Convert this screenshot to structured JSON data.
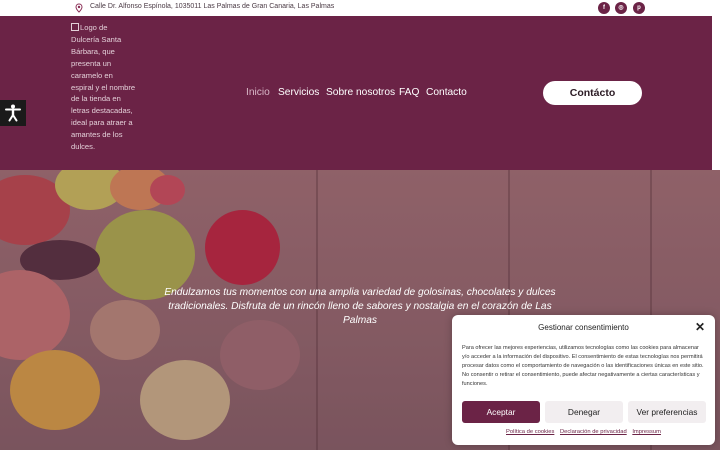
{
  "topbar": {
    "address_icon": "map-pin-icon",
    "address": "Calle Dr. Alfonso Espínola, 1035011 Las Palmas de Gran Canaria, Las Palmas",
    "social": [
      {
        "icon": "facebook-icon",
        "glyph": "f"
      },
      {
        "icon": "instagram-icon",
        "glyph": "◎"
      },
      {
        "icon": "pinterest-icon",
        "glyph": "p"
      }
    ]
  },
  "header": {
    "logo_alt": "Logo de Dulcería Santa Bárbara, que presenta un caramelo en espiral y el nombre de la tienda en letras destacadas, ideal para atraer a amantes de los dulces.",
    "nav": [
      {
        "label": "Inicio",
        "active": true
      },
      {
        "label": "Servicios",
        "active": false
      },
      {
        "label": "Sobre nosotros",
        "active": false
      },
      {
        "label": "FAQ",
        "active": false
      },
      {
        "label": "Contacto",
        "active": false
      }
    ],
    "cta_label": "Contácto",
    "background_color": "#6b2346"
  },
  "accessibility": {
    "icon": "accessibility-icon"
  },
  "hero": {
    "text": "Endulzamos tus momentos con una amplia variedad de golosinas, chocolates y dulces tradicionales. Disfruta de un rincón lleno de sabores y nostalgia en el corazón de Las Palmas"
  },
  "cookie_banner": {
    "title": "Gestionar consentimiento",
    "close_icon": "close-icon",
    "description": "Para ofrecer las mejores experiencias, utilizamos tecnologías como las cookies para almacenar y/o acceder a la información del dispositivo. El consentimiento de estas tecnologías nos permitirá procesar datos como el comportamiento de navegación o las identificaciones únicas en este sitio. No consentir o retirar el consentimiento, puede afectar negativamente a ciertas características y funciones.",
    "accept_label": "Aceptar",
    "deny_label": "Denegar",
    "preferences_label": "Ver preferencias",
    "links": [
      "Política de cookies",
      "Declaración de privacidad",
      "Impressum"
    ],
    "accent_color": "#6b2346"
  }
}
